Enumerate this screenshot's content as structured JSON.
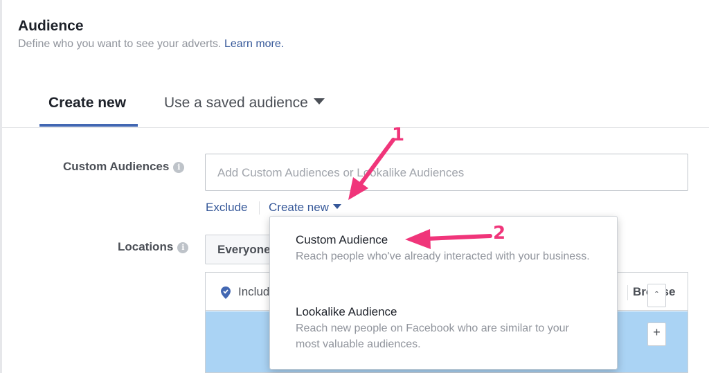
{
  "header": {
    "title": "Audience",
    "subtitle": "Define who you want to see your adverts.",
    "learn_more": "Learn more."
  },
  "tabs": {
    "create_new": "Create new",
    "saved": "Use a saved audience"
  },
  "custom_audiences": {
    "label": "Custom Audiences",
    "placeholder": "Add Custom Audiences or Lookalike Audiences",
    "exclude": "Exclude",
    "create_new": "Create new"
  },
  "locations": {
    "label": "Locations",
    "select_value": "Everyone",
    "include": "Include",
    "browse": "Browse"
  },
  "dropdown": {
    "items": [
      {
        "title": "Custom Audience",
        "description": "Reach people who've already interacted with your business."
      },
      {
        "title": "Lookalike Audience",
        "description": "Reach new people on Facebook who are similar to your most valuable audiences."
      }
    ]
  },
  "annotations": {
    "step1": "1",
    "step2": "2"
  },
  "colors": {
    "link": "#365899",
    "tab_underline": "#4267b2",
    "annotation": "#f0357a",
    "map_water": "#aad3f4"
  }
}
